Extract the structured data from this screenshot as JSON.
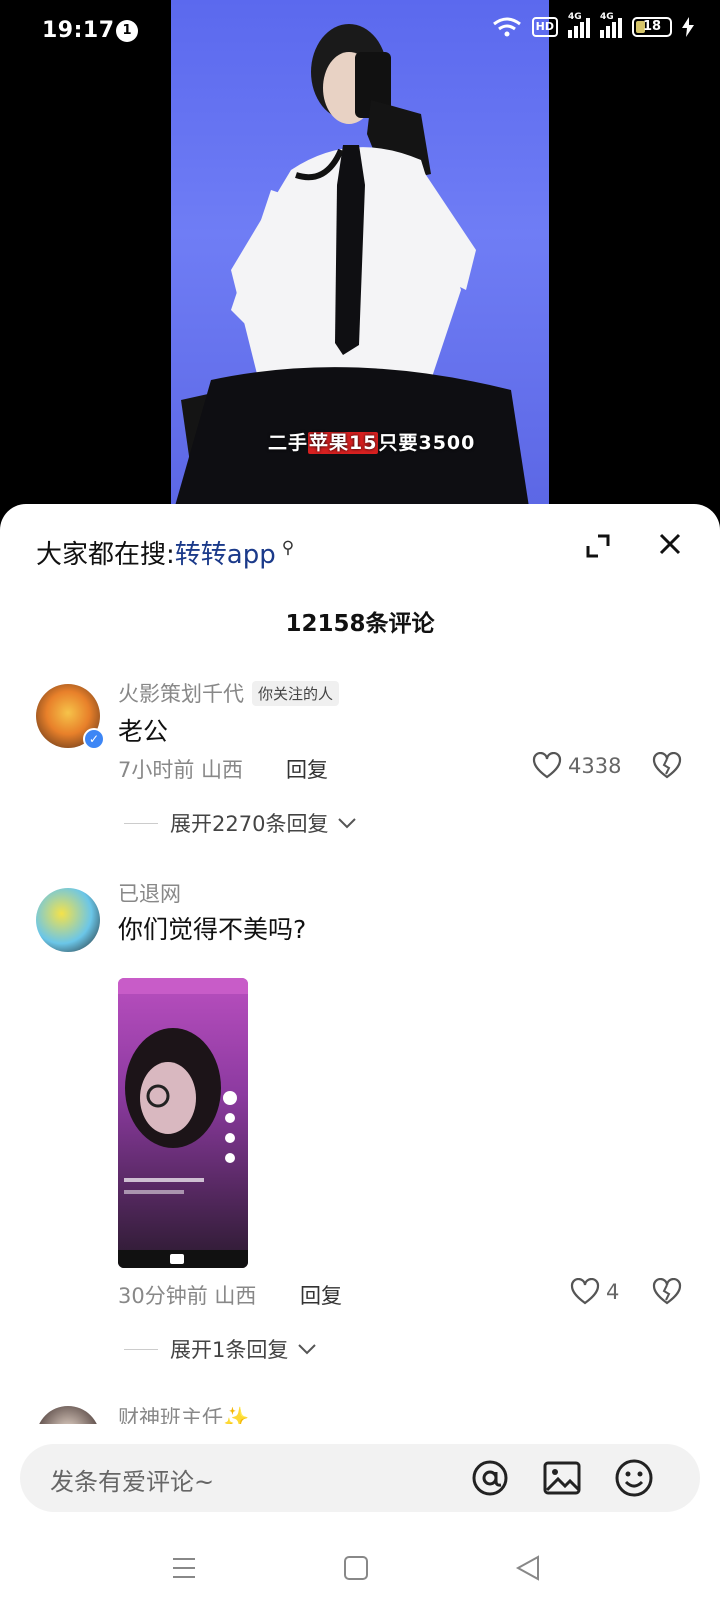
{
  "status_bar": {
    "time": "19:17",
    "notification_count": "1",
    "hd_label": "HD",
    "net1": "4G",
    "net2": "4G",
    "battery": "18"
  },
  "video": {
    "caption_prefix": "二手",
    "caption_highlight": "苹果15",
    "caption_suffix": "只要3500",
    "background_color": "#5b69ee"
  },
  "sheet": {
    "search_prefix": "大家都在搜:",
    "search_keyword": "转转app",
    "comment_count": "12158条评论"
  },
  "comments": [
    {
      "user": "火影策划千代",
      "tag": "你关注的人",
      "text": "老公",
      "time_location": "7小时前 山西",
      "reply_label": "回复",
      "likes": "4338",
      "expand_label": "展开2270条回复"
    },
    {
      "user": "已退网",
      "text": "你们觉得不美吗?",
      "time_location": "30分钟前 山西",
      "reply_label": "回复",
      "likes": "4",
      "expand_label": "展开1条回复"
    },
    {
      "user": "财神班主任✨"
    }
  ],
  "composer": {
    "placeholder": "发条有爱评论~"
  },
  "icons": {
    "expand": "expand-icon",
    "close": "close-icon",
    "heart": "heart-icon",
    "dislike": "broken-heart-icon",
    "at": "at-icon",
    "image": "image-icon",
    "emoji": "emoji-icon",
    "menu": "menu-icon",
    "home": "home-icon",
    "back": "back-icon"
  },
  "colors": {
    "keyword": "#1b3a8a",
    "verified": "#3d86f5",
    "caption_highlight": "#d62020"
  }
}
